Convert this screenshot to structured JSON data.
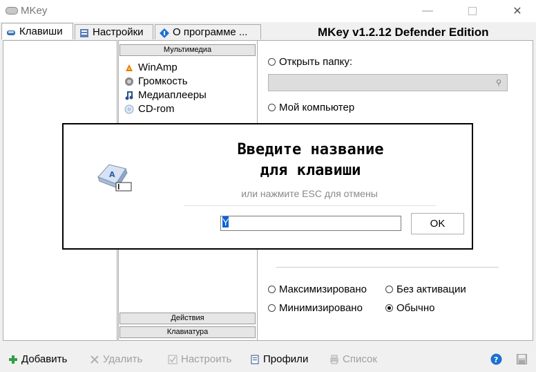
{
  "window": {
    "title": "MKey"
  },
  "tabs": [
    {
      "label": "Клавиши",
      "active": true,
      "icon": "keyboard-icon"
    },
    {
      "label": "Настройки",
      "active": false,
      "icon": "settings-icon"
    },
    {
      "label": "О программе ...",
      "active": false,
      "icon": "info-icon"
    }
  ],
  "edition": "MKey v1.2.12 Defender Edition",
  "categories": {
    "multimedia": "Мультимедиа",
    "actions": "Действия",
    "keyboard": "Клавиатура"
  },
  "multimedia_items": [
    {
      "label": "WinAmp",
      "icon": "winamp-icon"
    },
    {
      "label": "Громкость",
      "icon": "volume-icon"
    },
    {
      "label": "Медиаплееры",
      "icon": "music-note-icon"
    },
    {
      "label": "CD-rom",
      "icon": "cd-icon"
    }
  ],
  "options": {
    "open_folder": "Открыть папку:",
    "folder_value": "",
    "my_computer": "Мой компьютер",
    "maximized": "Максимизировано",
    "minimized": "Минимизировано",
    "no_activation": "Без активации",
    "normal": "Обычно"
  },
  "modal": {
    "title": "Введите название\nдля клавиши",
    "hint": "или нажмите ESC для отмены",
    "input_value": "Y",
    "ok_label": "OK"
  },
  "toolbar": {
    "add": "Добавить",
    "delete": "Удалить",
    "configure": "Настроить",
    "profiles": "Профили",
    "list": "Список"
  },
  "colors": {
    "selection": "#0a64d6",
    "add_icon": "#2ea043",
    "help_icon": "#1e6fd0"
  }
}
